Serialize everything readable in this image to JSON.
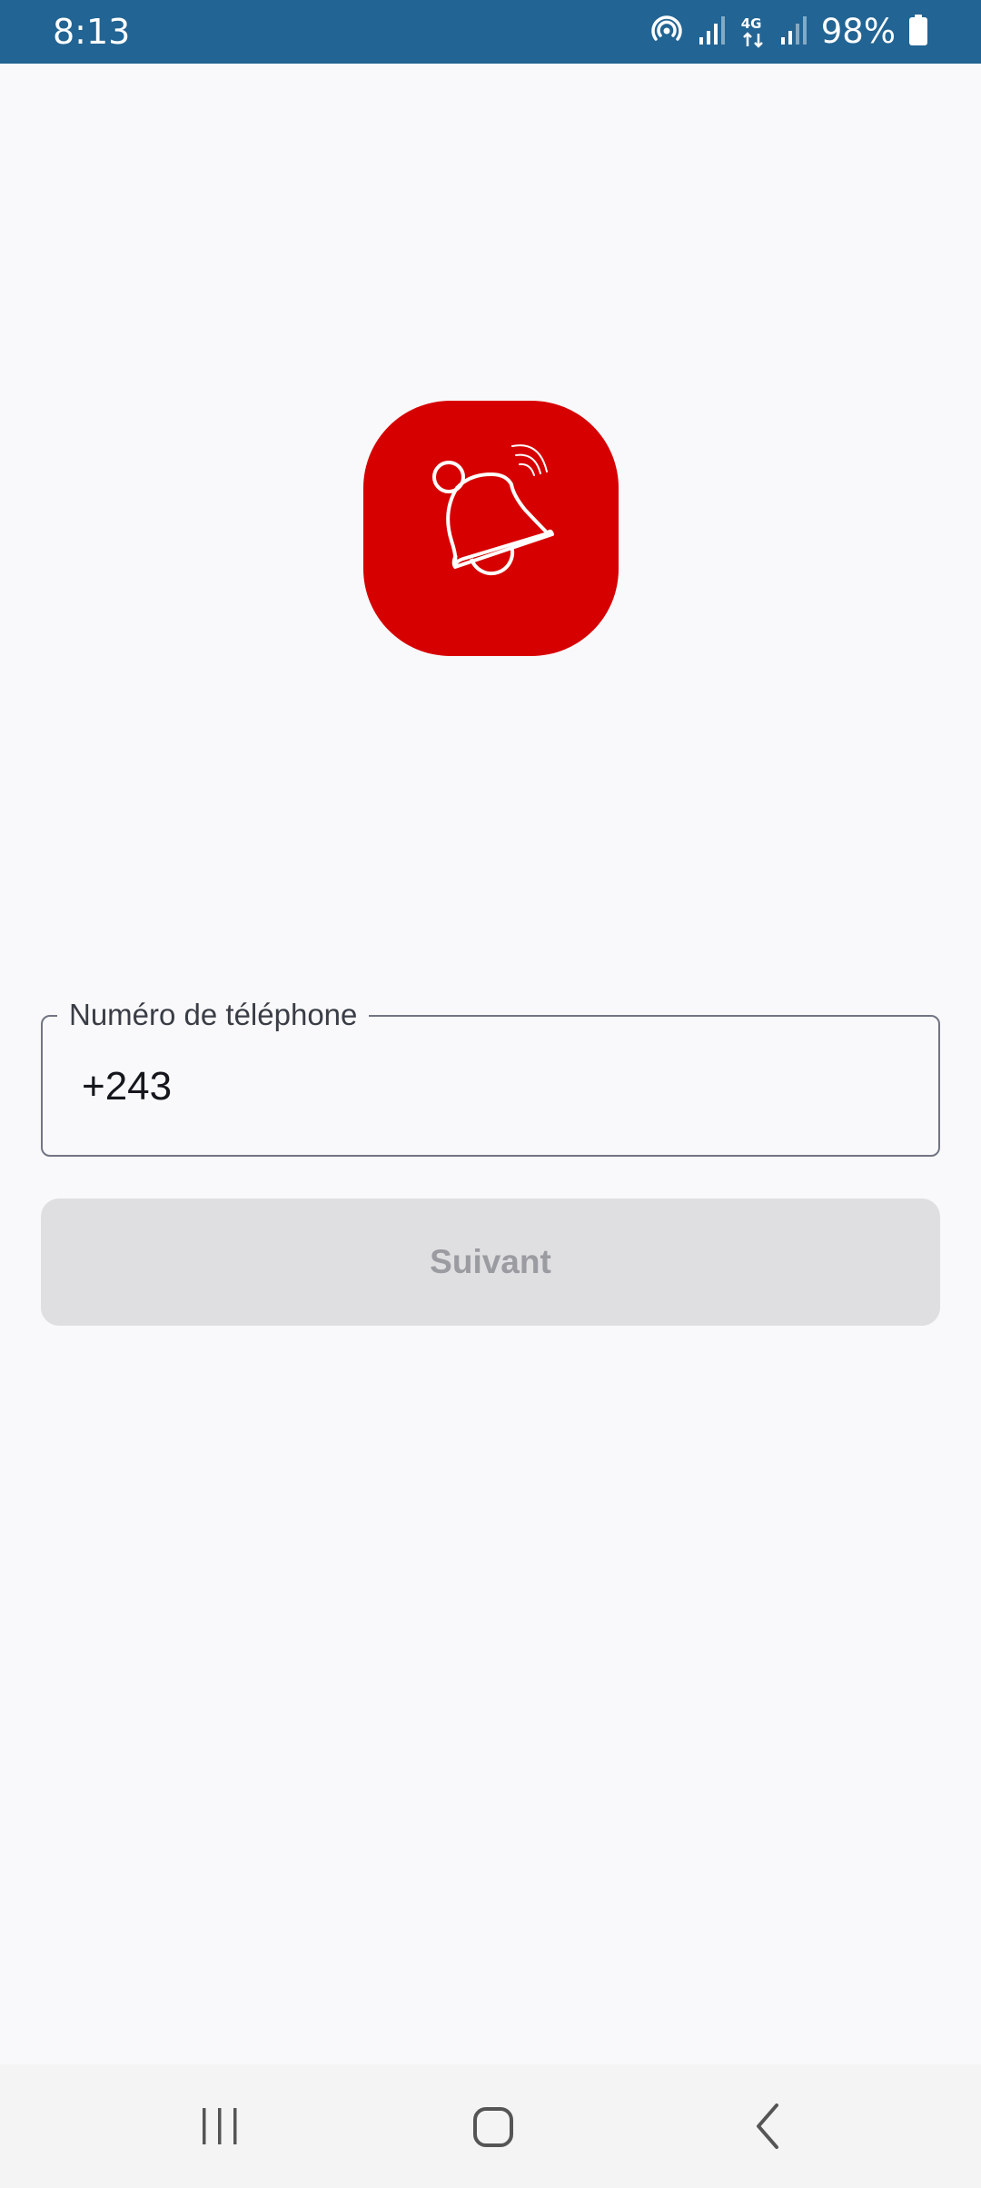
{
  "status_bar": {
    "time": "8:13",
    "battery_percent": "98%",
    "network_type": "4G",
    "icons": [
      "hotspot-icon",
      "signal-icon",
      "data-4g-icon",
      "signal-icon",
      "battery-icon"
    ]
  },
  "logo": {
    "icon": "bell-ringing-icon",
    "background_color": "#d70000"
  },
  "phone_field": {
    "label": "Numéro de téléphone",
    "value": "+243"
  },
  "next_button": {
    "label": "Suivant",
    "state": "disabled"
  },
  "nav_bar": {
    "icons": [
      "recent-apps-icon",
      "home-icon",
      "back-icon"
    ]
  },
  "colors": {
    "status_bar": "#226493",
    "background": "#f9f9fb",
    "accent": "#d70000",
    "button_disabled": "#dfdfe2"
  }
}
